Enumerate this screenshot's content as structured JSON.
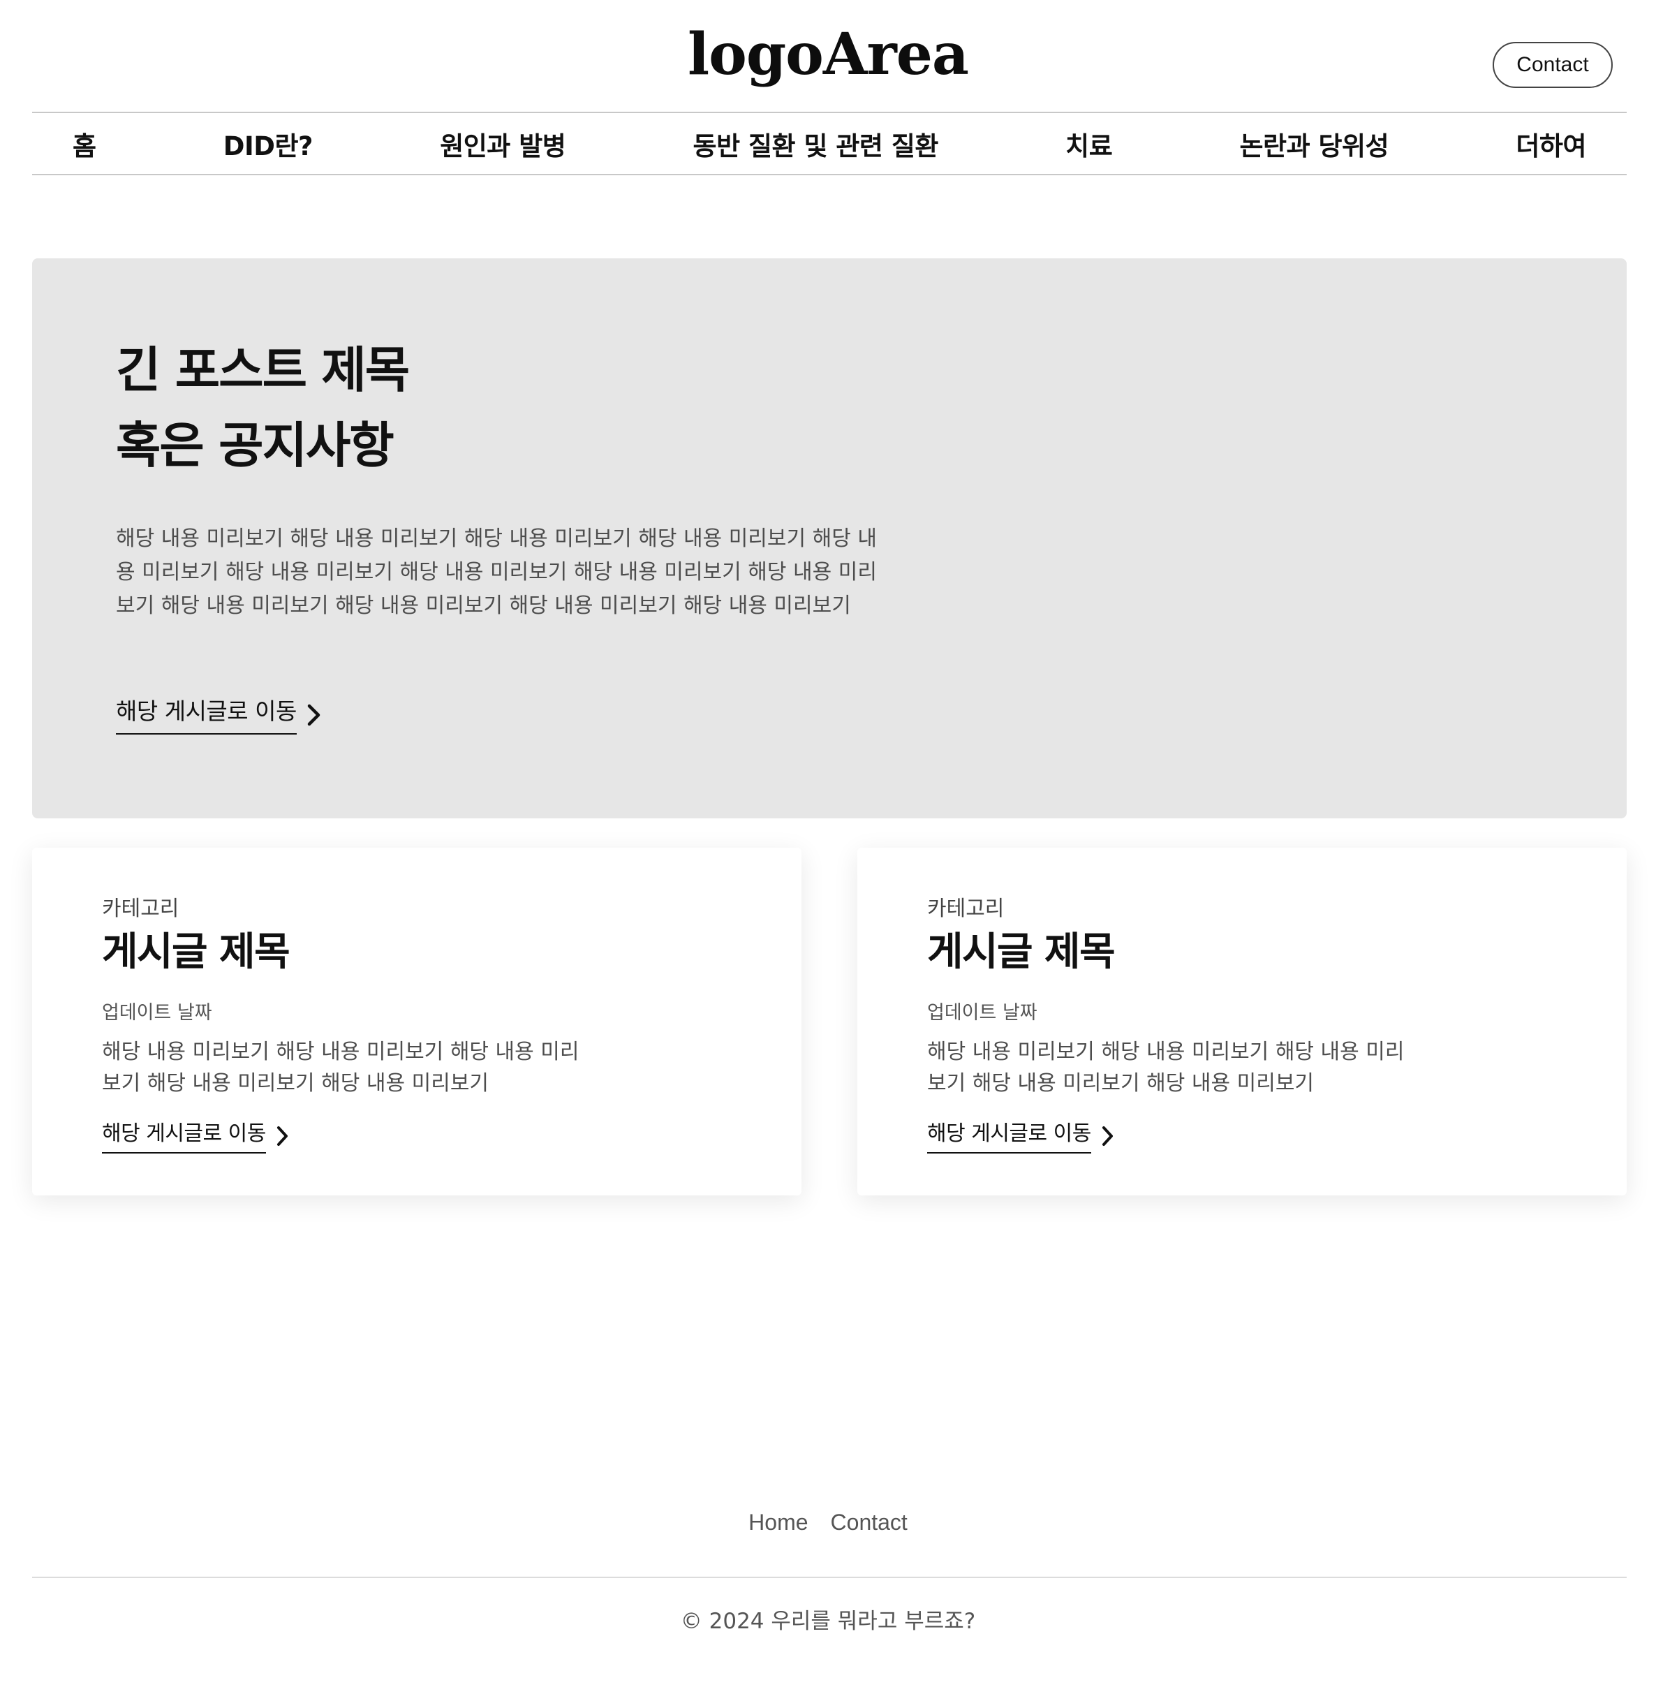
{
  "header": {
    "logo": "logoArea",
    "contact_label": "Contact"
  },
  "nav": {
    "items": [
      {
        "label": "홈"
      },
      {
        "label": "DID란?"
      },
      {
        "label": "원인과 발병"
      },
      {
        "label": "동반 질환 및 관련 질환"
      },
      {
        "label": "치료"
      },
      {
        "label": "논란과 당위성"
      },
      {
        "label": "더하여"
      }
    ]
  },
  "hero": {
    "title_line1": "긴 포스트 제목",
    "title_line2": "혹은 공지사항",
    "preview": "해당 내용 미리보기 해당 내용 미리보기 해당 내용 미리보기 해당 내용 미리보기 해당 내용 미리보기 해당 내용 미리보기 해당 내용 미리보기 해당 내용 미리보기 해당 내용 미리보기 해당 내용 미리보기 해당 내용 미리보기 해당 내용 미리보기 해당 내용 미리보기",
    "link_label": "해당 게시글로 이동"
  },
  "cards": [
    {
      "category": "카테고리",
      "title": "게시글 제목",
      "date": "업데이트 날짜",
      "preview": "해당 내용 미리보기 해당 내용 미리보기 해당 내용 미리보기 해당 내용 미리보기 해당 내용 미리보기",
      "link_label": "해당 게시글로 이동"
    },
    {
      "category": "카테고리",
      "title": "게시글 제목",
      "date": "업데이트 날짜",
      "preview": "해당 내용 미리보기 해당 내용 미리보기 해당 내용 미리보기 해당 내용 미리보기 해당 내용 미리보기",
      "link_label": "해당 게시글로 이동"
    }
  ],
  "footer": {
    "links": [
      {
        "label": "Home"
      },
      {
        "label": "Contact"
      }
    ],
    "copyright": "© 2024 우리를 뭐라고 부르죠?"
  },
  "icons": {
    "link_arrow": "chevron-right-icon"
  },
  "colors": {
    "hero_background": "#e6e6e6",
    "text_primary": "#111111",
    "text_secondary": "#4d4d4d"
  }
}
